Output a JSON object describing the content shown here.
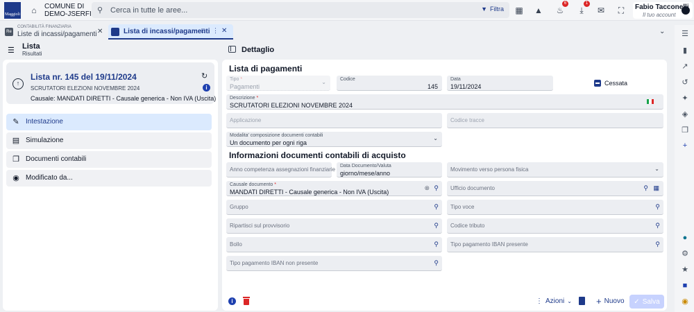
{
  "header": {
    "logo_text": "Maggioli",
    "org_line1": "COMUNE DI",
    "org_line2": "DEMO-JSERFIN",
    "search_placeholder": "Cerca in tutte le aree...",
    "filter_label": "Filtra",
    "notif_badge": "6",
    "download_badge": "1",
    "user_name": "Fabio Tacconelli",
    "user_role": "Il tuo account"
  },
  "tabs": [
    {
      "super": "CONTABILITÀ FINANZIARIA",
      "label": "Liste di incassi/pagamenti",
      "icon_text": "Re",
      "active": false
    },
    {
      "label": "Lista di incassi/pagamenti",
      "active": true
    }
  ],
  "left": {
    "title": "Lista",
    "subtitle": "Risultati",
    "card": {
      "title": "Lista nr. 145 del 19/11/2024",
      "subtitle": "SCRUTATORI ELEZIONI NOVEMBRE 2024",
      "causale": "Causale: MANDATI DIRETTI - Causale generica - Non IVA (Uscita)"
    },
    "nav": [
      {
        "label": "Intestazione",
        "icon": "pencil-icon",
        "active": true
      },
      {
        "label": "Simulazione",
        "icon": "simulation-icon",
        "active": false
      },
      {
        "label": "Documenti contabili",
        "icon": "documents-icon",
        "active": false
      },
      {
        "label": "Modificato da...",
        "icon": "fingerprint-icon",
        "active": false
      }
    ]
  },
  "detail": {
    "title": "Dettaglio",
    "section1": "Lista di pagamenti",
    "section2": "Informazioni documenti contabili di acquisto",
    "tipo": {
      "label": "Tipo",
      "value": "Pagamenti"
    },
    "codice": {
      "label": "Codice",
      "value": "145"
    },
    "data": {
      "label": "Data",
      "value": "19/11/2024"
    },
    "cessata": "Cessata",
    "descrizione": {
      "label": "Descrizione",
      "value": "SCRUTATORI ELEZIONI  NOVEMBRE 2024"
    },
    "applicazione": "Applicazione",
    "codice_tracce": "Codice tracce",
    "modalita": {
      "label": "Modalita' composizione documenti contabili",
      "value": "Un documento per ogni riga"
    },
    "anno": "Anno competenza assegnazioni finanziarie",
    "data_documento": {
      "label": "Data Documento/Valuta",
      "value": "giorno/mese/anno"
    },
    "movimento": "Movimento verso persona fisica",
    "causale": {
      "label": "Causale documento",
      "value": "MANDATI DIRETTI - Causale generica - Non IVA (Uscita)"
    },
    "ufficio": "Ufficio documento",
    "gruppo": "Gruppo",
    "tipo_voce": "Tipo voce",
    "ripartisci": "Ripartisci sul provvisorio",
    "codice_tributo": "Codice tributo",
    "bollo": "Bollo",
    "tipo_iban_presente": "Tipo pagamento IBAN presente",
    "tipo_iban_non_presente": "Tipo pagamento IBAN non presente"
  },
  "footer": {
    "azioni": "Azioni",
    "nuovo": "Nuovo",
    "salva": "Salva"
  },
  "colors": {
    "accent": "#1e3a8a",
    "active_bg": "#dbeafe",
    "danger": "#dc2626"
  }
}
